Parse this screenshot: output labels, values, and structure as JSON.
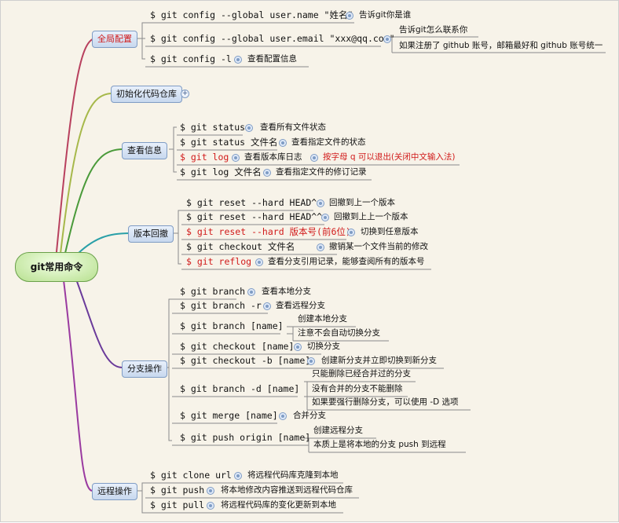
{
  "root": "git常用命令",
  "branches": {
    "global": "全局配置",
    "init": "初始化代码仓库",
    "view": "查看信息",
    "rollback": "版本回撤",
    "branch_ops": "分支操作",
    "remote": "远程操作"
  },
  "global": {
    "cmd1": "$ git config --global user.name \"姓名\"",
    "note1": "告诉git你是谁",
    "cmd2": "$ git config --global user.email \"xxx@qq.com\"",
    "note2a": "告诉git怎么联系你",
    "note2b": "如果注册了 github 账号，邮箱最好和 github 账号统一",
    "cmd3": "$ git config -l",
    "note3": "查看配置信息"
  },
  "view": {
    "cmd1": "$ git status",
    "note1": "查看所有文件状态",
    "cmd2": "$ git status 文件名",
    "note2": "查看指定文件的状态",
    "cmd3": "$ git log",
    "note3": "查看版本库日志",
    "note3b": "按字母 q 可以退出(关闭中文输入法)",
    "cmd4": "$ git log 文件名",
    "note4": "查看指定文件的修订记录"
  },
  "rollback": {
    "cmd1": "$ git reset --hard HEAD^",
    "note1": "回撤到上一个版本",
    "cmd2": "$ git reset --hard HEAD^^",
    "note2": "回撤到上上一个版本",
    "cmd3": "$ git reset --hard 版本号(前6位)",
    "note3": "切换到任意版本",
    "cmd4": "$ git checkout 文件名",
    "note4": "撤销某一个文件当前的修改",
    "cmd5": "$ git reflog",
    "note5": "查看分支引用记录，能够查阅所有的版本号"
  },
  "branch_ops": {
    "cmd1": "$ git branch",
    "note1": "查看本地分支",
    "cmd2": "$ git branch -r",
    "note2": "查看远程分支",
    "cmd3": "$ git branch [name]",
    "note3a": "创建本地分支",
    "note3b": "注意不会自动切换分支",
    "cmd4": "$ git checkout [name]",
    "note4": "切换分支",
    "cmd5": "$ git checkout -b [name]",
    "note5": "创建新分支并立即切换到新分支",
    "cmd6": "$ git branch -d [name]",
    "note6a": "只能删除已经合并过的分支",
    "note6b": "没有合并的分支不能删除",
    "note6c": "如果要强行删除分支，可以使用 -D 选项",
    "cmd7": "$ git merge [name]",
    "note7": "合并分支",
    "cmd8": "$ git push origin [name]",
    "note8a": "创建远程分支",
    "note8b": "本质上是将本地的分支 push 到远程"
  },
  "remote": {
    "cmd1": "$ git clone url",
    "note1": "将远程代码库克隆到本地",
    "cmd2": "$ git push",
    "note2": "将本地修改内容推送到远程代码仓库",
    "cmd3": "$ git pull",
    "note3": "将远程代码库的变化更新到本地"
  },
  "colors": {
    "global": "#b8405e",
    "init": "#a6b84a",
    "view": "#4a9a3a",
    "rollback": "#2aa0a8",
    "branch_ops": "#6a3a9a",
    "remote": "#9a3aa0",
    "accent_red": "#d11a1a"
  }
}
